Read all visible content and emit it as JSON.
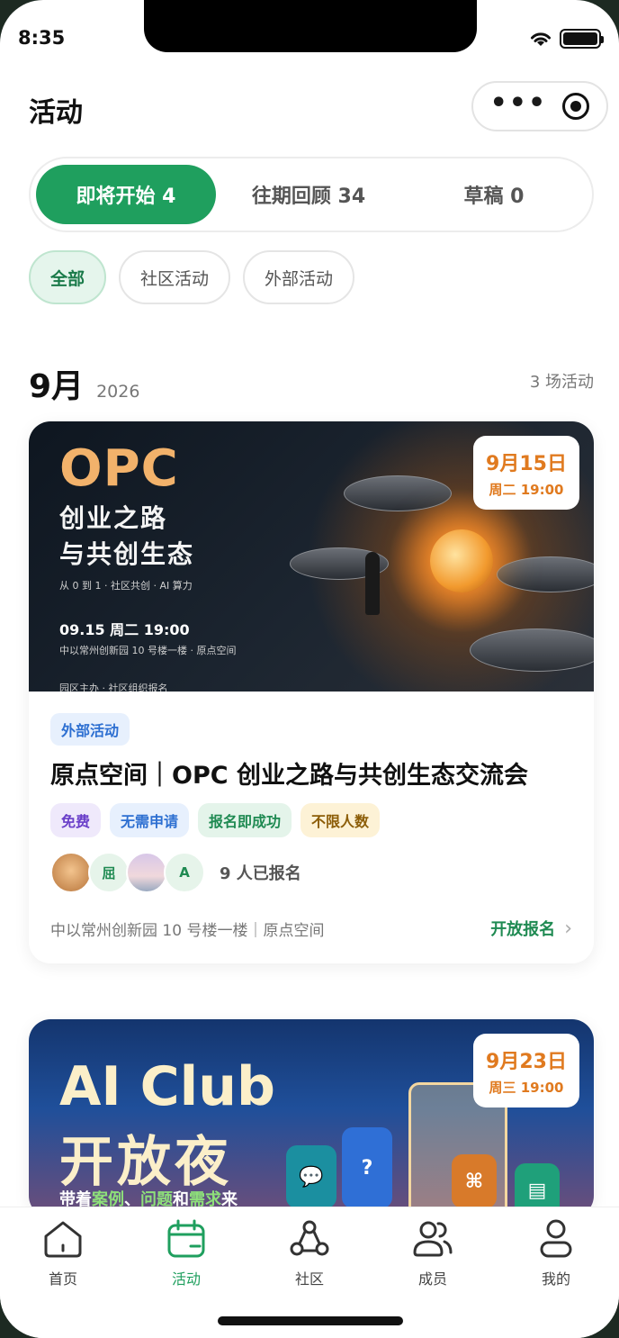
{
  "status": {
    "time": "8:35"
  },
  "header": {
    "title": "活动"
  },
  "segments": [
    {
      "label": "即将开始 4",
      "active": true
    },
    {
      "label": "往期回顾 34",
      "active": false
    },
    {
      "label": "草稿 0",
      "active": false
    }
  ],
  "filters": [
    {
      "label": "全部",
      "active": true
    },
    {
      "label": "社区活动",
      "active": false
    },
    {
      "label": "外部活动",
      "active": false
    }
  ],
  "month": {
    "label": "9月",
    "year": "2026",
    "count": "3 场活动"
  },
  "events": [
    {
      "date": "9月15日",
      "time": "周二 19:00",
      "banner_title": "OPC",
      "banner_sub1": "创业之路",
      "banner_sub2": "与共创生态",
      "banner_tagline": "从 0 到 1 · 社区共创 · AI 算力",
      "banner_datetime": "09.15 周二 19:00",
      "banner_location": "中以常州创新园 10 号楼一楼 · 原点空间",
      "banner_footer": "园区主办 · 社区组织报名",
      "category": "外部活动",
      "title": "原点空间｜OPC 创业之路与共创生态交流会",
      "tags": [
        "免费",
        "无需申请",
        "报名即成功",
        "不限人数"
      ],
      "avatars": [
        "",
        "屈",
        "",
        "A"
      ],
      "attendees": "9 人已报名",
      "location": "中以常州创新园 10 号楼一楼｜原点空间",
      "action": "开放报名"
    },
    {
      "date": "9月23日",
      "time": "周三 19:00",
      "banner_title": "AI Club",
      "banner_sub": "开放夜",
      "banner_line_pre": "带着",
      "banner_line_k1": "案例",
      "banner_line_sep": "、",
      "banner_line_k2": "问题",
      "banner_line_and": "和",
      "banner_line_k3": "需求",
      "banner_line_post": "来"
    }
  ],
  "tabbar": [
    {
      "label": "首页",
      "icon": "home-icon",
      "active": false
    },
    {
      "label": "活动",
      "icon": "calendar-icon",
      "active": true
    },
    {
      "label": "社区",
      "icon": "community-icon",
      "active": false
    },
    {
      "label": "成员",
      "icon": "members-icon",
      "active": false
    },
    {
      "label": "我的",
      "icon": "profile-icon",
      "active": false
    }
  ],
  "colors": {
    "accent": "#1f9f5e",
    "date": "#e07a1f"
  }
}
